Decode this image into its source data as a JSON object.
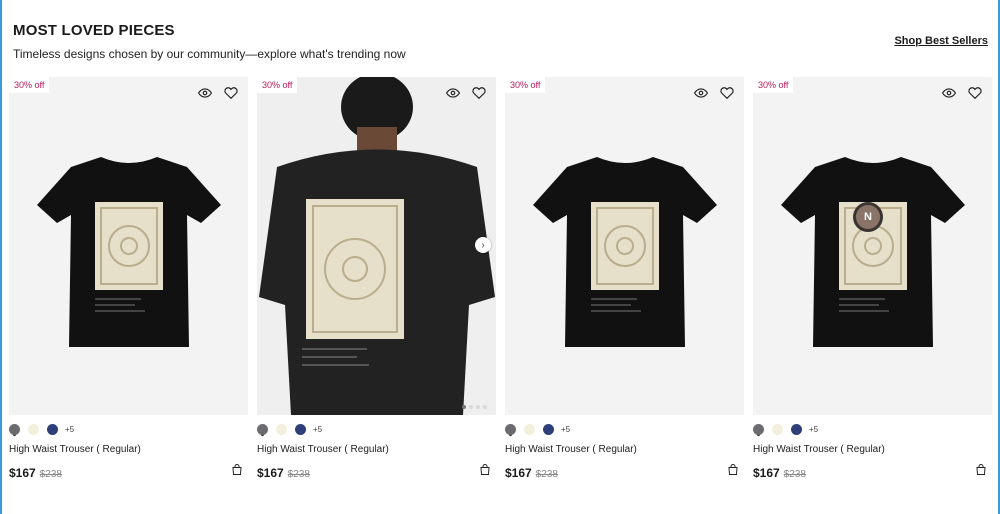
{
  "header": {
    "title": "MOST LOVED PIECES",
    "subtitle": "Timeless designs chosen by our community—explore what's trending now",
    "shop_link": "Shop Best Sellers"
  },
  "colors": {
    "frame": "#3d9bdc",
    "badge_text": "#c2185b",
    "swatch_gray": "#6b6b70",
    "swatch_cream": "#f3efdd",
    "swatch_navy": "#2e3f7a"
  },
  "products": [
    {
      "badge": "30% off",
      "name": "High Waist Trouser ( Regular)",
      "price": "$167",
      "old_price": "$238",
      "more_colors": "+5",
      "image": "black-tshirt-back-lace-print-flatlay"
    },
    {
      "badge": "30% off",
      "name": "High Waist Trouser ( Regular)",
      "price": "$167",
      "old_price": "$238",
      "more_colors": "+5",
      "image": "model-wearing-black-tshirt-back-view"
    },
    {
      "badge": "30% off",
      "name": "High Waist Trouser ( Regular)",
      "price": "$167",
      "old_price": "$238",
      "more_colors": "+5",
      "image": "black-tshirt-back-lace-print-flatlay"
    },
    {
      "badge": "30% off",
      "name": "High Waist Trouser ( Regular)",
      "price": "$167",
      "old_price": "$238",
      "more_colors": "+5",
      "image": "black-tshirt-back-lace-print-flatlay",
      "overlay_label": "N"
    }
  ],
  "icons": [
    "eye-icon",
    "heart-icon",
    "shopping-bag-icon",
    "chevron-right-icon"
  ]
}
